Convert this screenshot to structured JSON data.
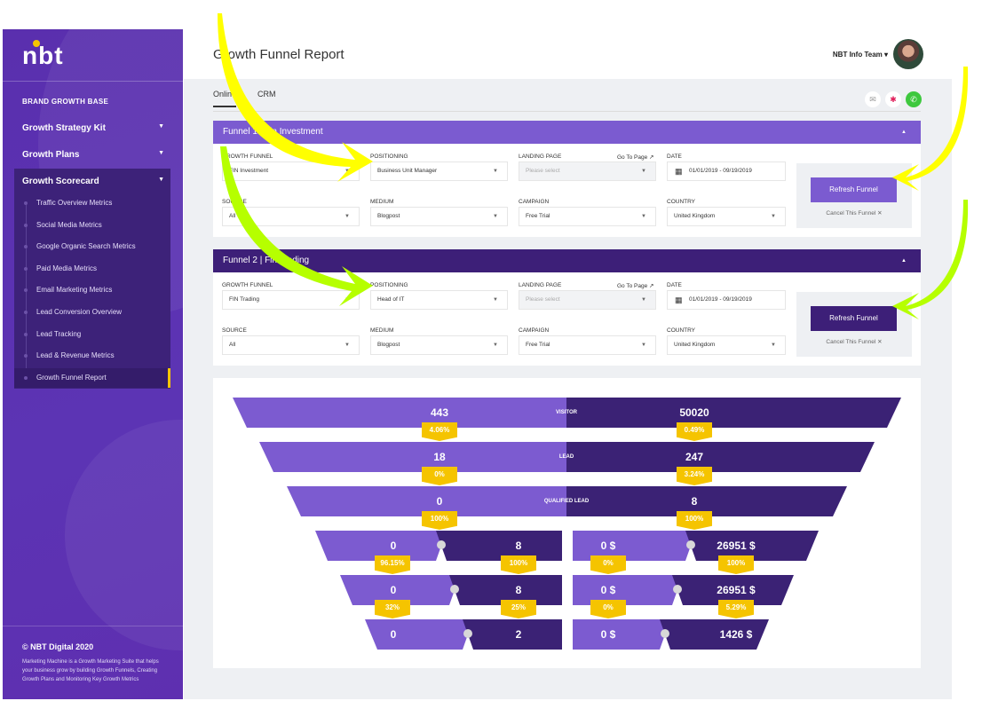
{
  "sidebar": {
    "logo": "nbt",
    "section": "BRAND GROWTH BASE",
    "items": [
      {
        "label": "Growth Strategy Kit"
      },
      {
        "label": "Growth Plans"
      },
      {
        "label": "Growth Scorecard"
      }
    ],
    "subitems": [
      "Traffic Overview Metrics",
      "Social Media Metrics",
      "Google Organic Search Metrics",
      "Paid Media Metrics",
      "Email Marketing Metrics",
      "Lead Conversion Overview",
      "Lead Tracking",
      "Lead & Revenue Metrics",
      "Growth Funnel Report"
    ],
    "active": "Growth Funnel Report",
    "copyright": "© NBT Digital 2020",
    "description": "Marketing Machine is a Growth Marketing Suite that helps your business grow by building Growth Funnels, Creating Growth Plans and Monitoring Key Growth Metrics"
  },
  "header": {
    "title": "Growth Funnel Report",
    "user": "NBT Info Team ▾"
  },
  "tabs": [
    {
      "label": "Online"
    },
    {
      "label": "CRM"
    }
  ],
  "share_icons": [
    "email-icon",
    "slack-icon",
    "whatsapp-icon"
  ],
  "labels": {
    "growth_funnel": "GROWTH FUNNEL",
    "positioning": "POSITIONING",
    "landing_page": "LANDING PAGE",
    "go_to_page": "Go To Page ↗",
    "date": "DATE",
    "source": "SOURCE",
    "medium": "MEDIUM",
    "campaign": "CAMPAIGN",
    "country": "COUNTRY",
    "refresh": "Refresh Funnel",
    "cancel": "Cancel This Funnel ✕"
  },
  "funnels": [
    {
      "title": "Funnel 1 | Fin Investment",
      "color": "#7b5bd0",
      "growth_funnel": "FIN Investment",
      "positioning": "Business Unit Manager",
      "landing_page": "Please select",
      "date": "01/01/2019 - 09/19/2019",
      "source": "All",
      "medium": "Blogpost",
      "campaign": "Free Trial",
      "country": "United Kingdom"
    },
    {
      "title": "Funnel 2 | Fin Trading",
      "color": "#3d1f78",
      "growth_funnel": "FIN Trading",
      "positioning": "Head of IT",
      "landing_page": "Please select",
      "date": "01/01/2019 - 09/19/2019",
      "source": "All",
      "medium": "Blogpost",
      "campaign": "Free Trial",
      "country": "United Kingdom"
    }
  ],
  "colors": {
    "light": "#7c5bd0",
    "dark": "#3b2275",
    "badge": "#f5c400"
  },
  "chart_data": {
    "type": "funnel",
    "stages": [
      {
        "name": "VISITOR",
        "left": "443",
        "right": "50020"
      },
      {
        "name": "LEAD",
        "left": "18",
        "right": "247"
      },
      {
        "name": "QUALIFIED LEAD",
        "left": "0",
        "right": "8"
      }
    ],
    "stage_rates": [
      {
        "left": "4.06%",
        "right": "0.49%"
      },
      {
        "left": "0%",
        "right": "3.24%"
      },
      {
        "left": "100%",
        "right": "100%"
      }
    ],
    "lower_rows": [
      {
        "a": "0",
        "b": "8",
        "c": "0 $",
        "d": "26951 $"
      },
      {
        "a": "0",
        "b": "8",
        "c": "0 $",
        "d": "26951 $"
      },
      {
        "a": "0",
        "b": "2",
        "c": "0 $",
        "d": "1426 $"
      }
    ],
    "lower_rates": [
      {
        "a": "96.15%",
        "b": "100%",
        "c": "0%",
        "d": "100%"
      },
      {
        "a": "32%",
        "b": "25%",
        "c": "0%",
        "d": "5.29%"
      }
    ]
  }
}
